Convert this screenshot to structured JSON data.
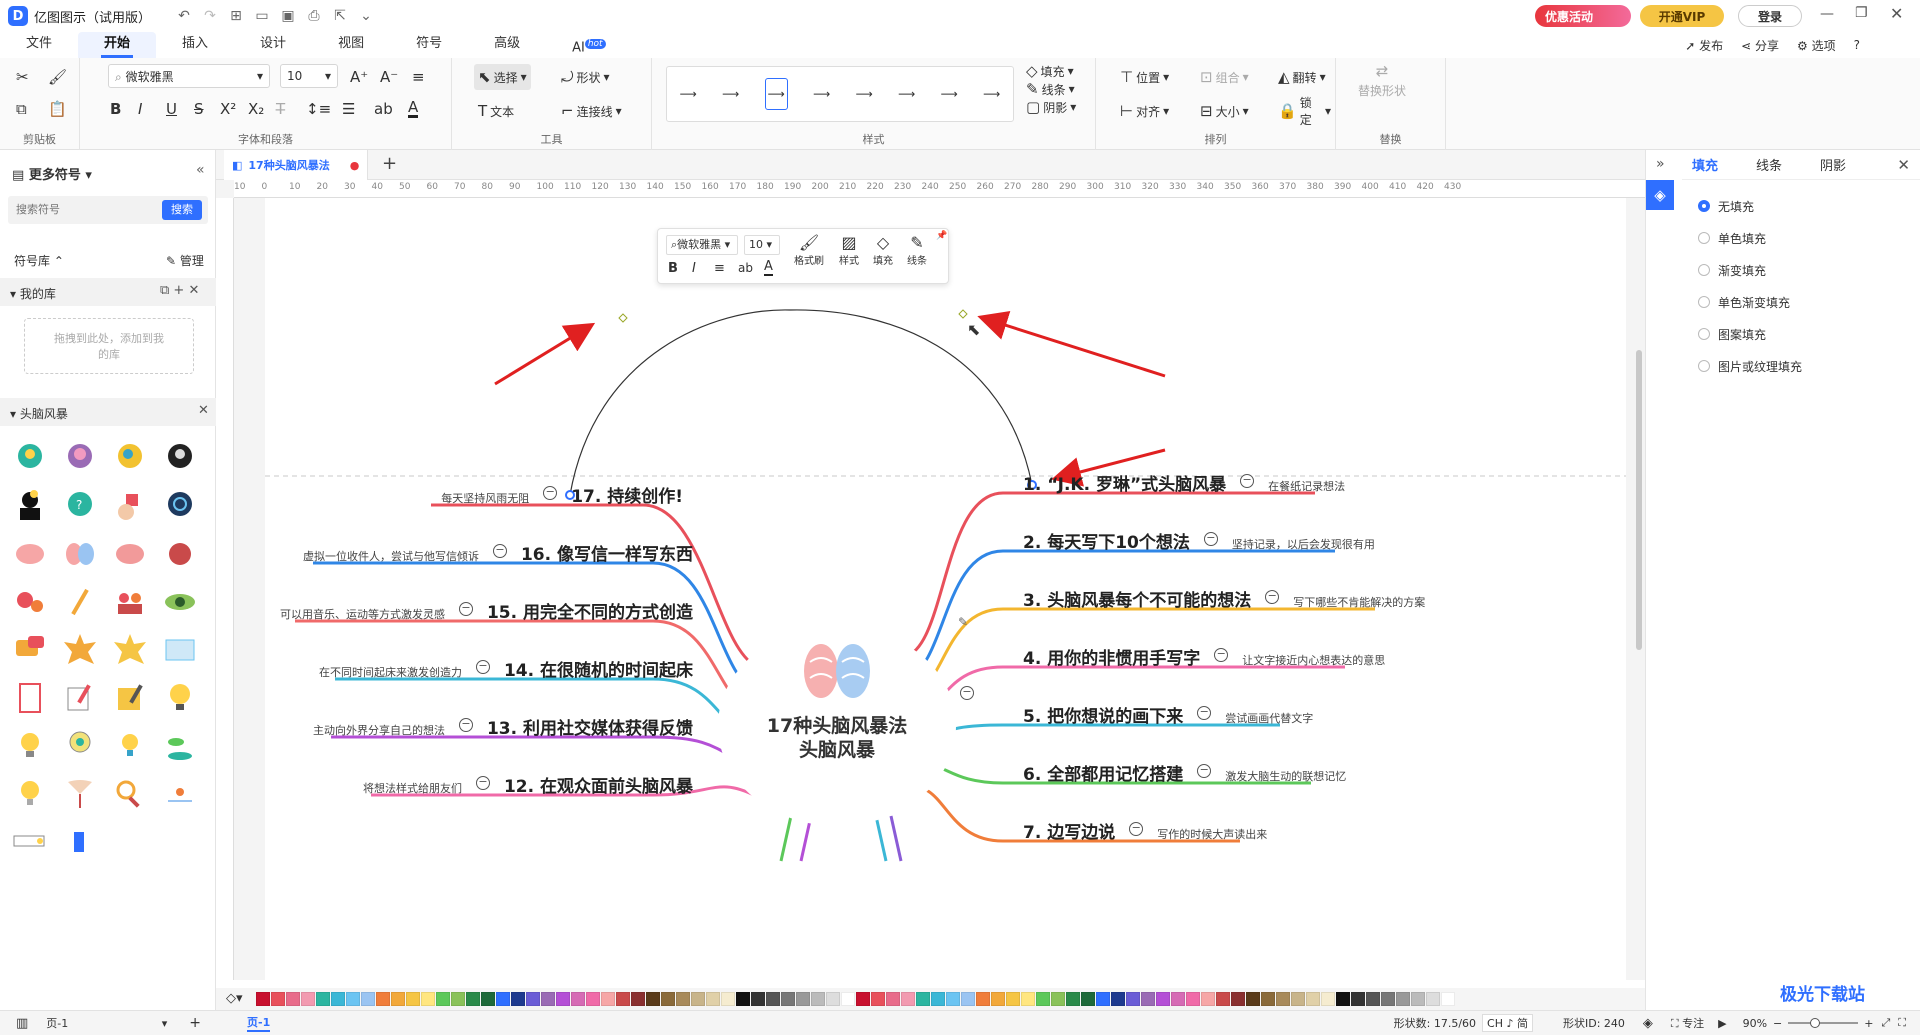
{
  "app": {
    "title": "亿图图示（试用版）",
    "promo": "优惠活动",
    "vip": "开通VIP",
    "login": "登录",
    "publish": "发布",
    "share": "分享",
    "options": "选项"
  },
  "menu": {
    "tabs": [
      "文件",
      "开始",
      "插入",
      "设计",
      "视图",
      "符号",
      "高级",
      "AI"
    ],
    "active": "开始",
    "ai_badge": "hot"
  },
  "ribbon": {
    "clipboard": "剪贴板",
    "font_group": "字体和段落",
    "tools_group": "工具",
    "style_group": "样式",
    "arrange_group": "排列",
    "replace_group": "替换",
    "font_name": "微软雅黑",
    "font_size": "10",
    "select": "选择",
    "shape": "形状",
    "text": "文本",
    "connector": "连接线",
    "fill": "填充",
    "line": "线条",
    "shadow": "阴影",
    "position": "位置",
    "group": "组合",
    "flip": "翻转",
    "align": "对齐",
    "size": "大小",
    "lock": "锁定",
    "replace_shape": "替换形状"
  },
  "left": {
    "more_symbols": "更多符号",
    "search_placeholder": "搜索符号",
    "search_btn": "搜索",
    "lib": "符号库",
    "manage": "管理",
    "my_lib": "我的库",
    "drop_hint": "拖拽到此处，添加到我的库",
    "brainstorm": "头脑风暴"
  },
  "doc": {
    "tab": "17种头脑风暴法"
  },
  "float_toolbar": {
    "font": "微软雅黑",
    "size": "10",
    "format_brush": "格式刷",
    "style": "样式",
    "fill": "填充",
    "line": "线条"
  },
  "mindmap": {
    "center": [
      "17种头脑风暴法",
      "头脑风暴"
    ],
    "right": [
      {
        "title": "1. “J.K. 罗琳”式头脑风暴",
        "note": "在餐纸记录想法",
        "color": "#e8505b"
      },
      {
        "title": "2. 每天写下10个想法",
        "note": "坚持记录，以后会发现很有用",
        "color": "#2f86e6"
      },
      {
        "title": "3. 头脑风暴每个不可能的想法",
        "note": "写下哪些不肯能解决的方案",
        "color": "#f3b62f"
      },
      {
        "title": "4. 用你的非惯用手写字",
        "note": "让文字接近内心想表达的意思",
        "color": "#f06aa8"
      },
      {
        "title": "5. 把你想说的画下来",
        "note": "尝试画画代替文字",
        "color": "#3bb7d6"
      },
      {
        "title": "6. 全部都用记忆搭建",
        "note": "激发大脑生动的联想记忆",
        "color": "#5cc85a"
      },
      {
        "title": "7. 边写边说",
        "note": "写作的时候大声读出来",
        "color": "#f07d3a"
      }
    ],
    "left": [
      {
        "title": "17. 持续创作!",
        "note": "每天坚持风雨无阻",
        "color": "#e8505b"
      },
      {
        "title": "16. 像写信一样写东西",
        "note": "虚拟一位收件人，尝试与他写信倾诉",
        "color": "#2f86e6"
      },
      {
        "title": "15. 用完全不同的方式创造",
        "note": "可以用音乐、运动等方式激发灵感",
        "color": "#f06a6a"
      },
      {
        "title": "14. 在很随机的时间起床",
        "note": "在不同时间起床来激发创造力",
        "color": "#3bb7d6"
      },
      {
        "title": "13. 利用社交媒体获得反馈",
        "note": "主动向外界分享自己的想法",
        "color": "#b44fd6"
      },
      {
        "title": "12. 在观众面前头脑风暴",
        "note": "将想法样式给朋友们",
        "color": "#f06aa8"
      }
    ]
  },
  "right_panel": {
    "tabs": [
      "填充",
      "线条",
      "阴影"
    ],
    "options": [
      "无填充",
      "单色填充",
      "渐变填充",
      "单色渐变填充",
      "图案填充",
      "图片或纹理填充"
    ],
    "selected": "无填充"
  },
  "status": {
    "page": "页-1",
    "page_tab": "页-1",
    "shape_count": "形状数: 17.5/60",
    "shape_id": "形状ID: 240",
    "focus": "专注",
    "zoom": "90%",
    "ime": "CH ♪ 简"
  },
  "watermark": "极光下载站",
  "colors": {
    "accent": "#2f6fff",
    "promo": "#e8363d",
    "vip": "#f5c544"
  }
}
